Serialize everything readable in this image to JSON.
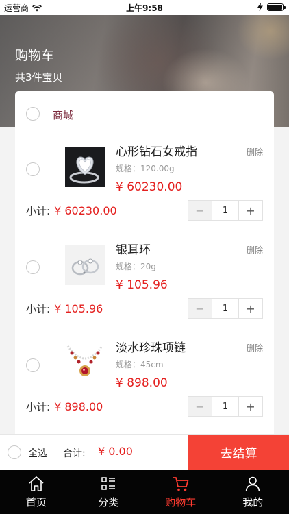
{
  "status_bar": {
    "carrier": "运营商",
    "time": "上午9:58"
  },
  "header": {
    "title": "购物车",
    "subtitle": "共3件宝贝"
  },
  "shop": {
    "name": "商城"
  },
  "items": [
    {
      "name": "心形钻石女戒指",
      "spec": "规格：120.00g",
      "price": "¥ 60230.00",
      "delete_label": "删除",
      "subtotal_label": "小计:",
      "subtotal": "¥ 60230.00",
      "quantity": "1",
      "thumb_icon": "heart-diamond-ring-image"
    },
    {
      "name": "银耳环",
      "spec": "规格：20g",
      "price": "¥ 105.96",
      "delete_label": "删除",
      "subtotal_label": "小计:",
      "subtotal": "¥ 105.96",
      "quantity": "1",
      "thumb_icon": "silver-earrings-image"
    },
    {
      "name": "淡水珍珠项链",
      "spec": "规格：45cm",
      "price": "¥ 898.00",
      "delete_label": "删除",
      "subtotal_label": "小计:",
      "subtotal": "¥ 898.00",
      "quantity": "1",
      "thumb_icon": "pearl-necklace-image"
    }
  ],
  "stepper": {
    "minus": "−",
    "plus": "+"
  },
  "checkout": {
    "select_all": "全选",
    "total_label": "合计:",
    "total": "¥ 0.00",
    "button": "去结算"
  },
  "tabbar": [
    {
      "label": "首页",
      "icon": "home-icon",
      "active": false
    },
    {
      "label": "分类",
      "icon": "category-icon",
      "active": false
    },
    {
      "label": "购物车",
      "icon": "cart-icon",
      "active": true
    },
    {
      "label": "我的",
      "icon": "user-icon",
      "active": false
    }
  ],
  "colors": {
    "accent": "#f44236",
    "price": "#e4201f",
    "shop": "#7b2a3c",
    "tab_active": "#ff3b30"
  }
}
